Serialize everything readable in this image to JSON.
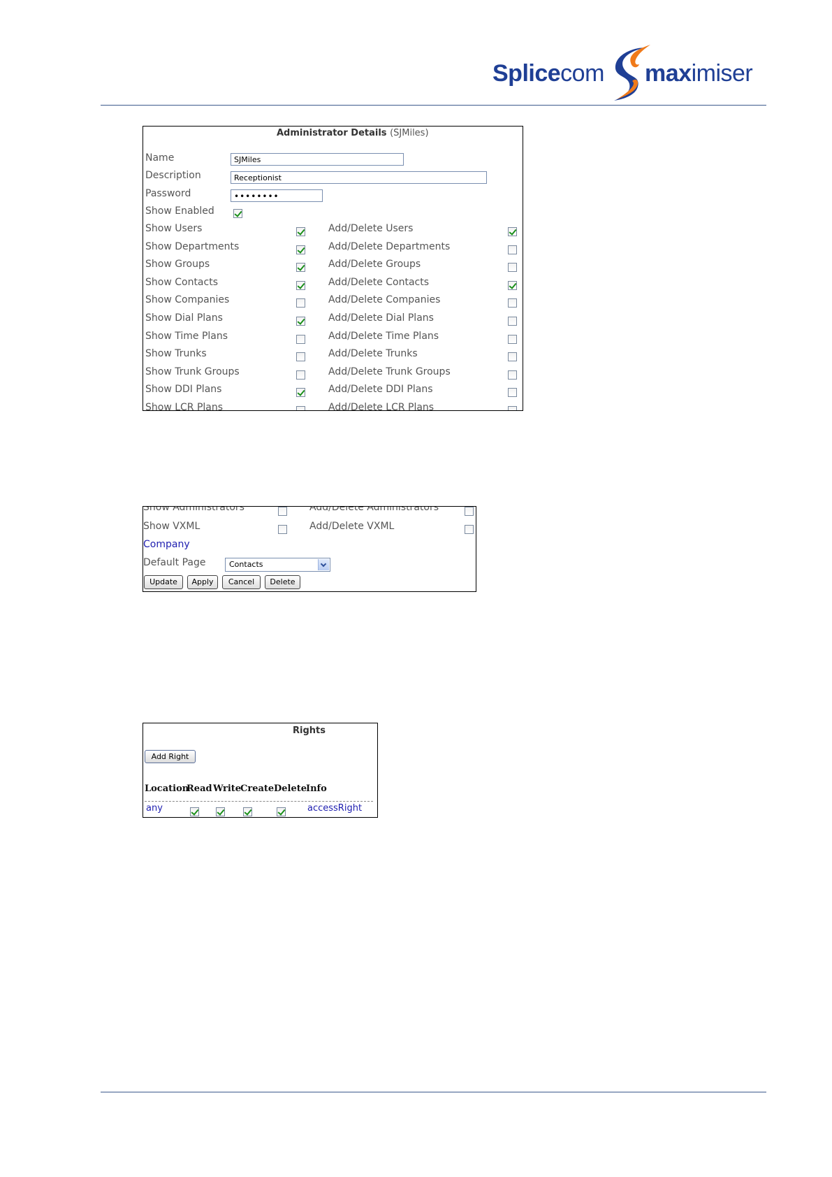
{
  "header": {
    "logo_part1": "Splice",
    "logo_part2": "com",
    "logo_part3": "max",
    "logo_part4": "imiser"
  },
  "admin_details": {
    "title": "Administrator Details",
    "title_sub": "(SJMiles)",
    "name_label": "Name",
    "name_value": "SJMiles",
    "description_label": "Description",
    "description_value": "Receptionist",
    "password_label": "Password",
    "password_value": "••••••••",
    "show_enabled_label": "Show Enabled",
    "show_enabled": true,
    "rights": [
      {
        "show": "Show Users",
        "show_on": true,
        "add": "Add/Delete Users",
        "add_on": true
      },
      {
        "show": "Show Departments",
        "show_on": true,
        "add": "Add/Delete Departments",
        "add_on": false
      },
      {
        "show": "Show Groups",
        "show_on": true,
        "add": "Add/Delete Groups",
        "add_on": false
      },
      {
        "show": "Show Contacts",
        "show_on": true,
        "add": "Add/Delete Contacts",
        "add_on": true
      },
      {
        "show": "Show Companies",
        "show_on": false,
        "add": "Add/Delete Companies",
        "add_on": false
      },
      {
        "show": "Show Dial Plans",
        "show_on": true,
        "add": "Add/Delete Dial Plans",
        "add_on": false
      },
      {
        "show": "Show Time Plans",
        "show_on": false,
        "add": "Add/Delete Time Plans",
        "add_on": false
      },
      {
        "show": "Show Trunks",
        "show_on": false,
        "add": "Add/Delete Trunks",
        "add_on": false
      },
      {
        "show": "Show Trunk Groups",
        "show_on": false,
        "add": "Add/Delete Trunk Groups",
        "add_on": false
      },
      {
        "show": "Show DDI Plans",
        "show_on": true,
        "add": "Add/Delete DDI Plans",
        "add_on": false
      },
      {
        "show": "Show LCR Plans",
        "show_on": false,
        "add": "Add/Delete LCR Plans",
        "add_on": false
      }
    ]
  },
  "admin_details_2": {
    "row_admin_show": "Show Administrators",
    "row_admin_add": "Add/Delete Administrators",
    "row_vxml_show": "Show VXML",
    "row_vxml_add": "Add/Delete VXML",
    "company_link": "Company",
    "default_page_label": "Default Page",
    "default_page_value": "Contacts",
    "buttons": {
      "update": "Update",
      "apply": "Apply",
      "cancel": "Cancel",
      "delete": "Delete"
    }
  },
  "rights_panel": {
    "title": "Rights",
    "add_button": "Add Right",
    "columns": [
      "Location",
      "Read",
      "Write",
      "Create",
      "Delete",
      "Info"
    ],
    "row": {
      "location": "any",
      "read": true,
      "write": true,
      "create": true,
      "delete": true,
      "info": "accessRight"
    }
  },
  "colors": {
    "brand": "#1f3f95",
    "swoosh": "#f07a1a",
    "check": "#1a8f1a",
    "link": "#1f1fb0"
  }
}
